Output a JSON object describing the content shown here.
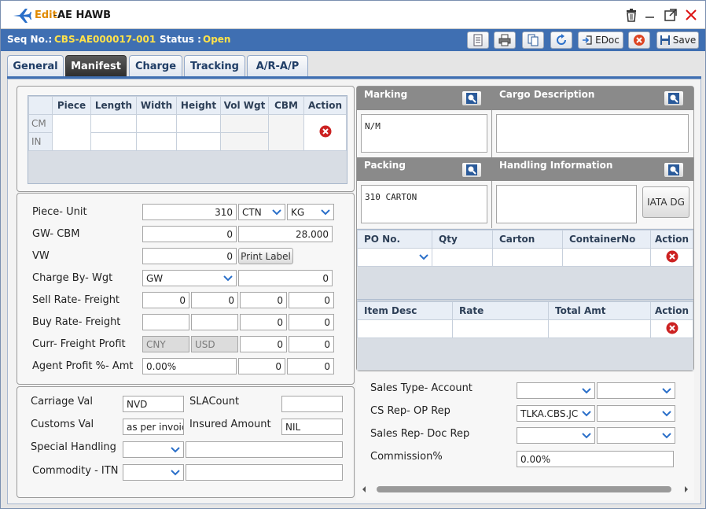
{
  "window": {
    "mode": "Edit",
    "sep": " - ",
    "title": "AE HAWB"
  },
  "seqbar": {
    "seq_label": "Seq No.:",
    "seq_value": "CBS-AE000017-001",
    "status_label": "Status :",
    "status_value": "Open",
    "edoc_label": "EDoc",
    "save_label": "Save"
  },
  "tabs": [
    "General",
    "Manifest",
    "Charge",
    "Tracking",
    "A/R-A/P"
  ],
  "dims": {
    "headers": [
      "Piece",
      "Length",
      "Width",
      "Height",
      "Vol Wgt",
      "CBM",
      "Action"
    ],
    "row_labels": [
      "CM",
      "IN"
    ]
  },
  "form": {
    "piece_unit": {
      "label": "Piece- Unit",
      "piece": "310",
      "unit": "CTN",
      "wunit": "KG"
    },
    "gw_cbm": {
      "label": "GW- CBM",
      "gw": "0",
      "cbm": "28.000"
    },
    "vw": {
      "label": "VW",
      "value": "0",
      "print_label": "Print Label"
    },
    "charge_by": {
      "label": "Charge By- Wgt",
      "value": "GW",
      "wgt": "0"
    },
    "sell_rate": {
      "label": "Sell Rate- Freight",
      "v1": "0",
      "v2": "0",
      "v3": "0",
      "v4": "0"
    },
    "buy_rate": {
      "label": "Buy Rate- Freight",
      "v1": "",
      "v2": "",
      "v3": "0",
      "v4": "0"
    },
    "curr_profit": {
      "label": "Curr- Freight Profit",
      "c1": "CNY",
      "c2": "USD",
      "v3": "0",
      "v4": "0"
    },
    "agent_profit": {
      "label": "Agent Profit %- Amt",
      "pct": "0.00%",
      "v3": "0",
      "v4": "0"
    }
  },
  "lower": {
    "carriage_label": "Carriage Val",
    "carriage_value": "NVD",
    "sla_label": "SLACount",
    "sla_value": "",
    "customs_label": "Customs Val",
    "customs_value": "as per invoic",
    "insured_label": "Insured Amount",
    "insured_value": "NIL",
    "special_label": "Special Handling",
    "commodity_label": "Commodity -  ITN"
  },
  "right": {
    "marking_label": "Marking",
    "marking_value": "N/M",
    "cargo_label": "Cargo Description",
    "cargo_value": "",
    "packing_label": "Packing",
    "packing_value": "310 CARTON",
    "handling_label": "Handling Information",
    "handling_value": "",
    "iata_label": "IATA DG",
    "po_headers": [
      "PO No.",
      "Qty",
      "Carton",
      "ContainerNo",
      "Action"
    ],
    "item_headers": [
      "Item Desc",
      "Rate",
      "Total Amt",
      "Action"
    ],
    "sales_type_label": "Sales Type- Account",
    "cs_rep_label": "CS Rep- OP Rep",
    "cs_rep_value": "TLKA.CBS.JC",
    "sales_rep_label": "Sales Rep- Doc Rep",
    "commission_label": "Commission%",
    "commission_value": "0.00%"
  },
  "colors": {
    "accent": "#3f6fb2",
    "status": "#ffe24a",
    "delete": "#cc2222"
  }
}
